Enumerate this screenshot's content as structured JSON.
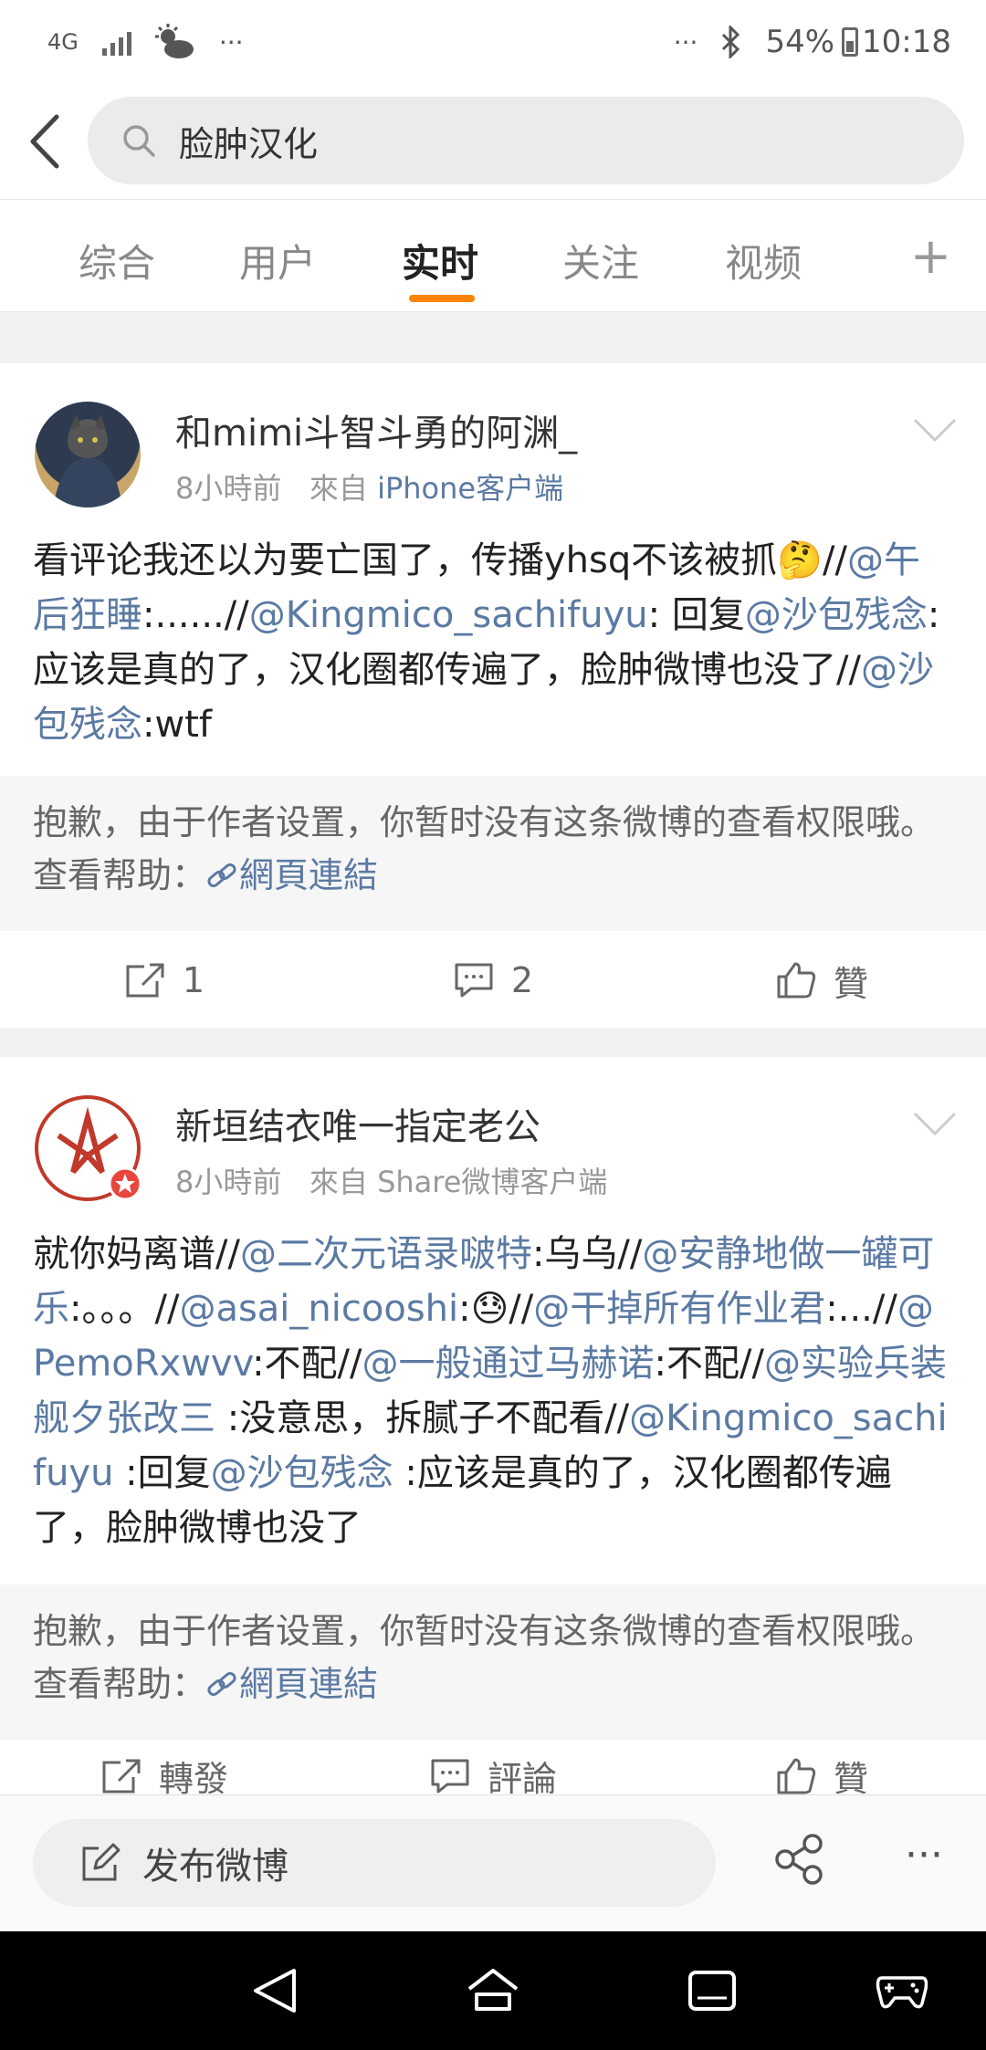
{
  "status_bar": {
    "network_label": "4G",
    "more_dots_left": "···",
    "more_dots_right": "···",
    "battery_percent": "54%",
    "time": "10:18"
  },
  "search": {
    "query": "脸肿汉化"
  },
  "tabs": [
    "综合",
    "用户",
    "实时",
    "关注",
    "视频"
  ],
  "active_tab": "实时",
  "posts": [
    {
      "username": "和mimi斗智斗勇的阿渊_",
      "time": "8小時前",
      "from_label": "來自",
      "source": "iPhone客户端",
      "text_segments": [
        {
          "t": "看评论我还以为要亡国了，传播yhsq不该被抓🤔//"
        },
        {
          "t": "@午后狂睡",
          "m": true
        },
        {
          "t": ":......//"
        },
        {
          "t": "@Kingmico_sachifuyu",
          "m": true
        },
        {
          "t": ": 回复"
        },
        {
          "t": "@沙包残念",
          "m": true
        },
        {
          "t": ":应该是真的了，汉化圈都传遍了，脸肿微博也没了//"
        },
        {
          "t": "@沙包残念",
          "m": true
        },
        {
          "t": ":wtf"
        }
      ],
      "notice": "抱歉，由于作者设置，你暂时没有这条微博的查看权限哦。查看帮助：",
      "notice_link": "網頁連結",
      "repost": "1",
      "comment": "2",
      "like": "贊"
    },
    {
      "username": "新垣结衣唯一指定老公",
      "time": "8小時前",
      "from_label": "來自",
      "source": "Share微博客户端",
      "text_segments": [
        {
          "t": "就你妈离谱//"
        },
        {
          "t": "@二次元语录啵特",
          "m": true
        },
        {
          "t": ":乌乌//"
        },
        {
          "t": "@安静地做一罐可乐",
          "m": true
        },
        {
          "t": ":。。。//"
        },
        {
          "t": "@asai_nicooshi",
          "m": true
        },
        {
          "t": ":😓//"
        },
        {
          "t": "@干掉所有作业君",
          "m": true
        },
        {
          "t": ":...//"
        },
        {
          "t": "@PemoRxwvv",
          "m": true
        },
        {
          "t": ":不配//"
        },
        {
          "t": "@一般通过马赫诺",
          "m": true
        },
        {
          "t": ":不配//"
        },
        {
          "t": "@实验兵装舰夕张改三",
          "m": true
        },
        {
          "t": " :没意思，拆腻子不配看//"
        },
        {
          "t": "@Kingmico_sachifuyu",
          "m": true
        },
        {
          "t": " :回复"
        },
        {
          "t": "@沙包残念",
          "m": true
        },
        {
          "t": " :应该是真的了，汉化圈都传遍了，脸肿微博也没了"
        }
      ],
      "notice": "抱歉，由于作者设置，你暂时没有这条微博的查看权限哦。查看帮助：",
      "notice_link": "網頁連結",
      "repost": "轉發",
      "comment": "評論",
      "like": "贊"
    }
  ],
  "compose": {
    "label": "发布微博"
  },
  "bottom_more": "···",
  "colors": {
    "accent": "#ff8200",
    "mention": "#5b7aa3",
    "nav_bg": "#000000"
  }
}
